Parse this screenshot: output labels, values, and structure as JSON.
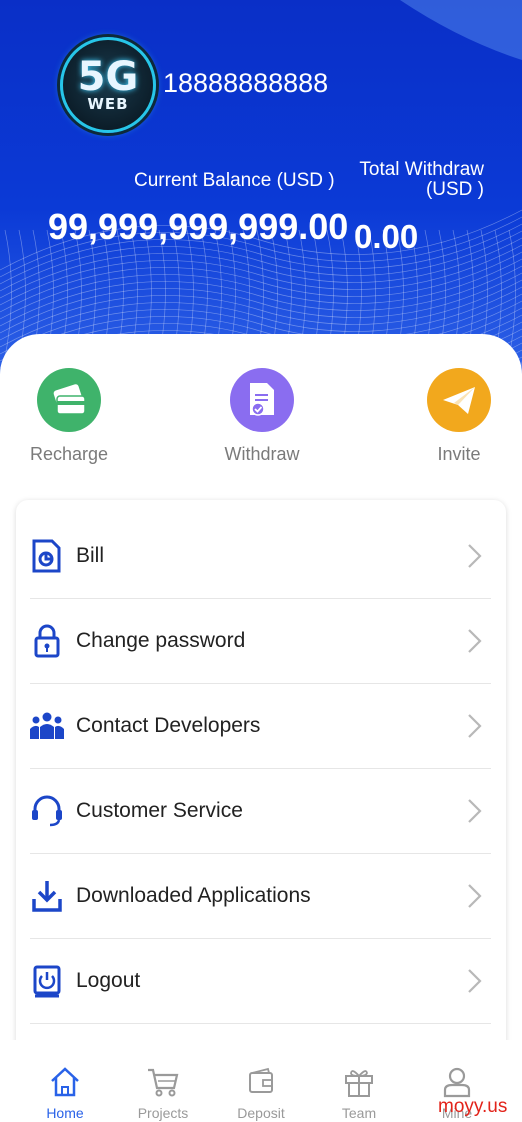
{
  "user": {
    "avatar_text_top": "5G",
    "avatar_text_bottom": "WEB",
    "phone": "18888888888"
  },
  "balance": {
    "current_label": "Current Balance (USD )",
    "current_value": "99,999,999,999.00",
    "withdraw_label_line1": "Total Withdraw",
    "withdraw_label_line2": "(USD )",
    "withdraw_value": "0.00"
  },
  "quick_actions": [
    {
      "label": "Recharge",
      "icon": "credit-card-icon",
      "color": "#3fb36b"
    },
    {
      "label": "Withdraw",
      "icon": "document-check-icon",
      "color": "#8a6df0"
    },
    {
      "label": "Invite",
      "icon": "paper-plane-icon",
      "color": "#f2a81d"
    }
  ],
  "menu": [
    {
      "label": "Bill",
      "icon": "bill-icon"
    },
    {
      "label": "Change password",
      "icon": "lock-icon"
    },
    {
      "label": "Contact Developers",
      "icon": "people-icon"
    },
    {
      "label": "Customer Service",
      "icon": "headset-icon"
    },
    {
      "label": "Downloaded Applications",
      "icon": "download-icon"
    },
    {
      "label": "Logout",
      "icon": "power-icon"
    }
  ],
  "tabs": [
    {
      "label": "Home",
      "icon": "home-icon",
      "active": true
    },
    {
      "label": "Projects",
      "icon": "cart-icon",
      "active": false
    },
    {
      "label": "Deposit",
      "icon": "wallet-icon",
      "active": false
    },
    {
      "label": "Team",
      "icon": "gift-icon",
      "active": false
    },
    {
      "label": "Mine",
      "icon": "user-icon",
      "active": false
    }
  ],
  "watermark": "moyy.us",
  "colors": {
    "header_blue": "#0b3ad6",
    "menu_icon_blue": "#1c46c8",
    "active_tab": "#2962e8"
  }
}
